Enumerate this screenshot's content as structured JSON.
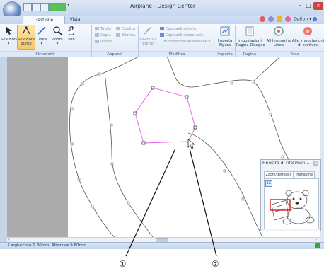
{
  "window": {
    "title": "Airplane - Design Center",
    "minimize": "–",
    "maximize": "□",
    "close": "×"
  },
  "tabs": [
    {
      "label": "Gestione immagine",
      "active": true
    },
    {
      "label": "Vista",
      "active": false
    }
  ],
  "option_label": "Option",
  "ribbon": {
    "groups": [
      {
        "label": "Strumenti"
      },
      {
        "label": "Appunti"
      },
      {
        "label": "Modifica"
      },
      {
        "label": "Importa"
      },
      {
        "label": "Pagina Disegno"
      },
      {
        "label": "Fase"
      }
    ],
    "strumenti": [
      {
        "label": "Selezione\n▾",
        "icon": "arrow-cursor-icon"
      },
      {
        "label": "Selezione\npunto",
        "icon": "point-select-icon",
        "selected": true
      },
      {
        "label": "Linea\n▾",
        "icon": "line-icon"
      },
      {
        "label": "Zoom\n▾",
        "icon": "zoom-icon"
      },
      {
        "label": "Pan",
        "icon": "hand-icon"
      }
    ],
    "appunti": {
      "taglia": "Taglia",
      "duplica": "Duplica",
      "copia": "Copia",
      "elimina": "Elimina",
      "incolla": "Incolla"
    },
    "modifica": {
      "dividi": "Dividi su\npunto",
      "settate": "Capisaldi settate",
      "orizzontale": "Capisaldi orizzontale",
      "numeriche": "Impostazioni Numeriche ▾"
    },
    "importa": {
      "label": "Importa\nFigura"
    },
    "pagina": {
      "label": "Impostazioni\nPagina Disegno"
    },
    "fase": [
      {
        "label": "All Immagine\nLinea"
      },
      {
        "label": "Alle impostazioni\ndi cucitura"
      }
    ]
  },
  "status": {
    "text": "Larghezza= 9.30mm, Altezza= 9.60mm"
  },
  "reference_window": {
    "title": "Finestra di riferimen...",
    "close": "x",
    "tabs": [
      "Zoom/dettaglio",
      "Immagine"
    ],
    "zoom_value": "1X"
  },
  "callouts": [
    "①",
    "②"
  ],
  "colors": {
    "selection": "#e85ae8",
    "outline": "#555555",
    "ref_box": "#d42020",
    "status_ok": "#3aa33a"
  }
}
